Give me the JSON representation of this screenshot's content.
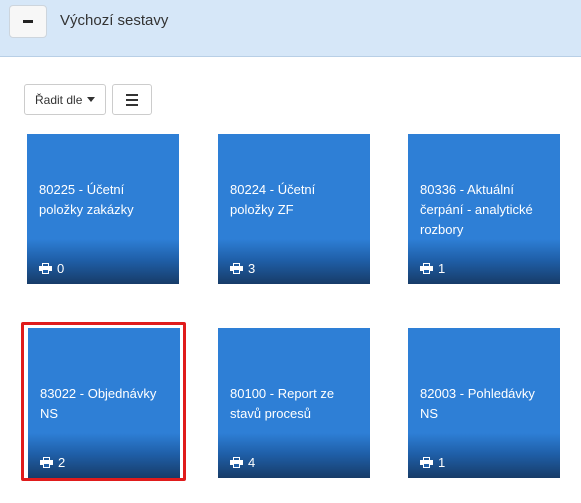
{
  "header": {
    "title": "Výchozí sestavy"
  },
  "toolbar": {
    "sort_label": "Řadit dle"
  },
  "tiles": [
    {
      "label": "80225 - Účetní položky zakázky",
      "count": "0"
    },
    {
      "label": "80224 - Účetní položky ZF",
      "count": "3"
    },
    {
      "label": "80336 - Aktuální čerpání - analytické rozbory",
      "count": "1"
    },
    {
      "label": "83022 - Objednávky NS",
      "count": "2"
    },
    {
      "label": "80100 - Report ze stavů procesů",
      "count": "4"
    },
    {
      "label": "82003 - Pohledávky NS",
      "count": "1"
    }
  ]
}
